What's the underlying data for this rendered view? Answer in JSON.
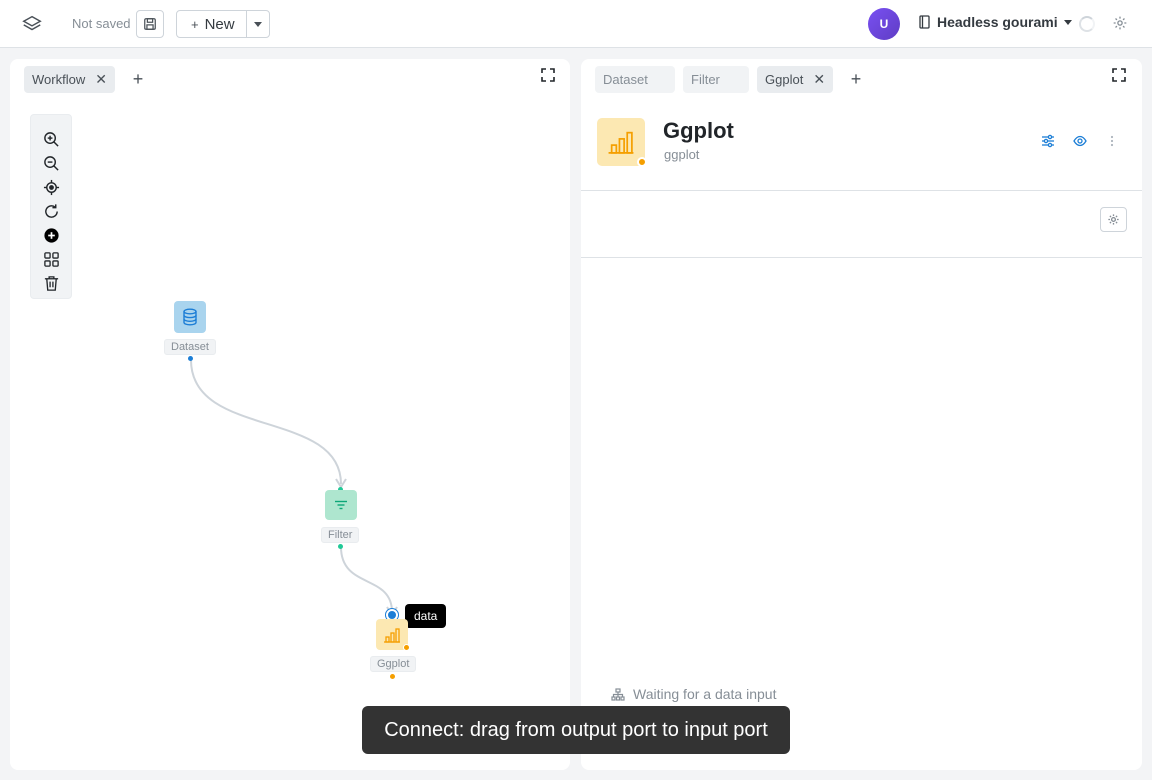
{
  "header": {
    "save_status": "Not saved",
    "new_button": {
      "icon": "plus-icon",
      "label": "New"
    },
    "avatar_initial": "U",
    "project_name": "Headless gourami"
  },
  "workflow_panel": {
    "tabs": [
      {
        "label": "Workflow",
        "active": true
      }
    ],
    "toolbar": [
      "zoom-in-icon",
      "zoom-out-icon",
      "locate-icon",
      "refresh-icon",
      "add-circle-icon",
      "grid-icon",
      "trash-icon"
    ],
    "nodes": [
      {
        "label": "Dataset",
        "color": "#a9d4ee",
        "icon": "database-icon"
      },
      {
        "label": "Filter",
        "color": "#aee6cf",
        "icon": "filter-icon"
      },
      {
        "label": "Ggplot",
        "color": "#fce8b2",
        "icon": "bar-chart-icon"
      }
    ],
    "port_tooltip": "data"
  },
  "detail_panel": {
    "tabs": [
      {
        "label": "Dataset",
        "active": false
      },
      {
        "label": "Filter",
        "active": false
      },
      {
        "label": "Ggplot",
        "active": true
      }
    ],
    "title": "Ggplot",
    "subtitle": "ggplot",
    "status_color": "#f59f00",
    "waiting_text": "Waiting for a data input"
  },
  "toast": "Connect: drag from output port to input port",
  "colors": {
    "accent": "#1c7ed6",
    "ggplot": "#f59f00",
    "filter": "#20c997"
  }
}
